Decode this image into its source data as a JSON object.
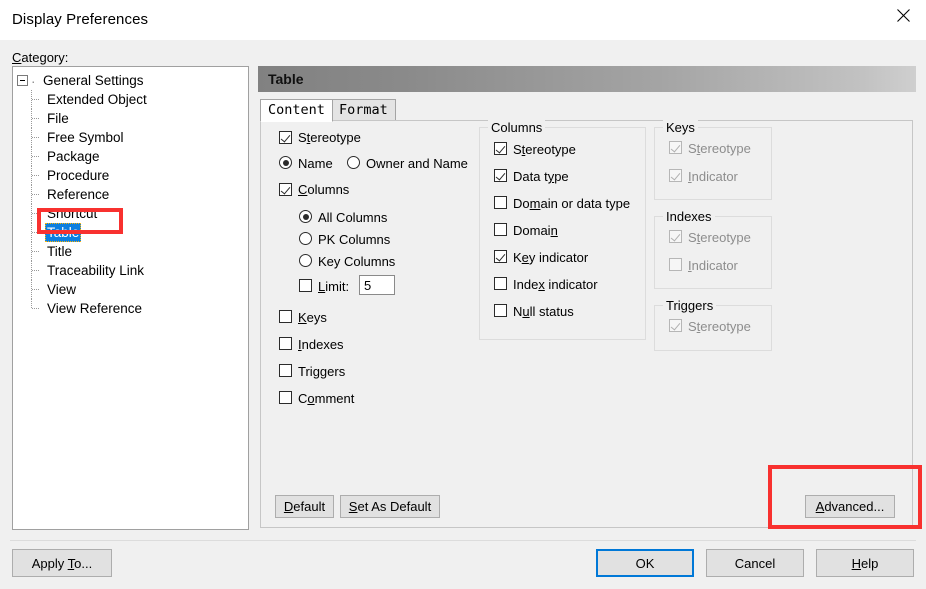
{
  "window": {
    "title": "Display Preferences",
    "close_icon": "close-icon"
  },
  "sidebar": {
    "label": "Category:",
    "items": [
      {
        "label": "General Settings",
        "level": 0,
        "selected": false
      },
      {
        "label": "Extended Object",
        "level": 1,
        "selected": false
      },
      {
        "label": "File",
        "level": 1,
        "selected": false
      },
      {
        "label": "Free Symbol",
        "level": 1,
        "selected": false
      },
      {
        "label": "Package",
        "level": 1,
        "selected": false
      },
      {
        "label": "Procedure",
        "level": 1,
        "selected": false
      },
      {
        "label": "Reference",
        "level": 1,
        "selected": false
      },
      {
        "label": "Shortcut",
        "level": 1,
        "selected": false
      },
      {
        "label": "Table",
        "level": 1,
        "selected": true
      },
      {
        "label": "Title",
        "level": 1,
        "selected": false
      },
      {
        "label": "Traceability Link",
        "level": 1,
        "selected": false
      },
      {
        "label": "View",
        "level": 1,
        "selected": false
      },
      {
        "label": "View Reference",
        "level": 1,
        "selected": false
      }
    ]
  },
  "main": {
    "header_title": "Table",
    "tabs": [
      {
        "label": "Content",
        "active": true
      },
      {
        "label": "Format",
        "active": false
      }
    ],
    "left_options": {
      "stereotype": {
        "label": "Stereotype",
        "accel": "t",
        "checked": true
      },
      "name_radio": {
        "label": "Name",
        "selected": true
      },
      "owner_and_name_radio": {
        "label": "Owner and Name",
        "selected": false
      },
      "columns": {
        "label": "Columns",
        "accel": "C",
        "checked": true
      },
      "all_columns_radio": {
        "label": "All Columns",
        "selected": true
      },
      "pk_columns_radio": {
        "label": "PK Columns",
        "selected": false
      },
      "key_columns_radio": {
        "label": "Key Columns",
        "selected": false
      },
      "limit": {
        "label": "Limit:",
        "accel": "L",
        "checked": false,
        "value": "5"
      },
      "keys": {
        "label": "Keys",
        "accel": "K",
        "checked": false
      },
      "indexes": {
        "label": "Indexes",
        "accel": "I",
        "checked": false
      },
      "triggers": {
        "label": "Triggers",
        "accel": "g",
        "checked": false
      },
      "comment": {
        "label": "Comment",
        "accel": "o",
        "checked": false
      }
    },
    "columns_group": {
      "title": "Columns",
      "items": [
        {
          "label": "Stereotype",
          "checked": true,
          "disabled": false
        },
        {
          "label": "Data type",
          "checked": true,
          "disabled": false
        },
        {
          "label": "Domain or data type",
          "checked": false,
          "disabled": false
        },
        {
          "label": "Domain",
          "checked": false,
          "disabled": false
        },
        {
          "label": "Key indicator",
          "checked": true,
          "disabled": false
        },
        {
          "label": "Index indicator",
          "checked": false,
          "disabled": false
        },
        {
          "label": "Null status",
          "checked": false,
          "disabled": false
        }
      ]
    },
    "keys_group": {
      "title": "Keys",
      "items": [
        {
          "label": "Stereotype",
          "checked": true,
          "disabled": true
        },
        {
          "label": "Indicator",
          "checked": true,
          "disabled": true
        }
      ]
    },
    "indexes_group": {
      "title": "Indexes",
      "items": [
        {
          "label": "Stereotype",
          "checked": true,
          "disabled": true
        },
        {
          "label": "Indicator",
          "checked": false,
          "disabled": true
        }
      ]
    },
    "triggers_group": {
      "title": "Triggers",
      "items": [
        {
          "label": "Stereotype",
          "checked": true,
          "disabled": true
        }
      ]
    },
    "panel_buttons": {
      "default": "Default",
      "set_as_default": "Set As Default",
      "advanced": "Advanced..."
    }
  },
  "footer": {
    "apply_to": "Apply To...",
    "ok": "OK",
    "cancel": "Cancel",
    "help": "Help"
  },
  "annotations": {
    "color": "#f8312f",
    "targets": [
      "sidebar-item-table",
      "advanced-button"
    ]
  }
}
